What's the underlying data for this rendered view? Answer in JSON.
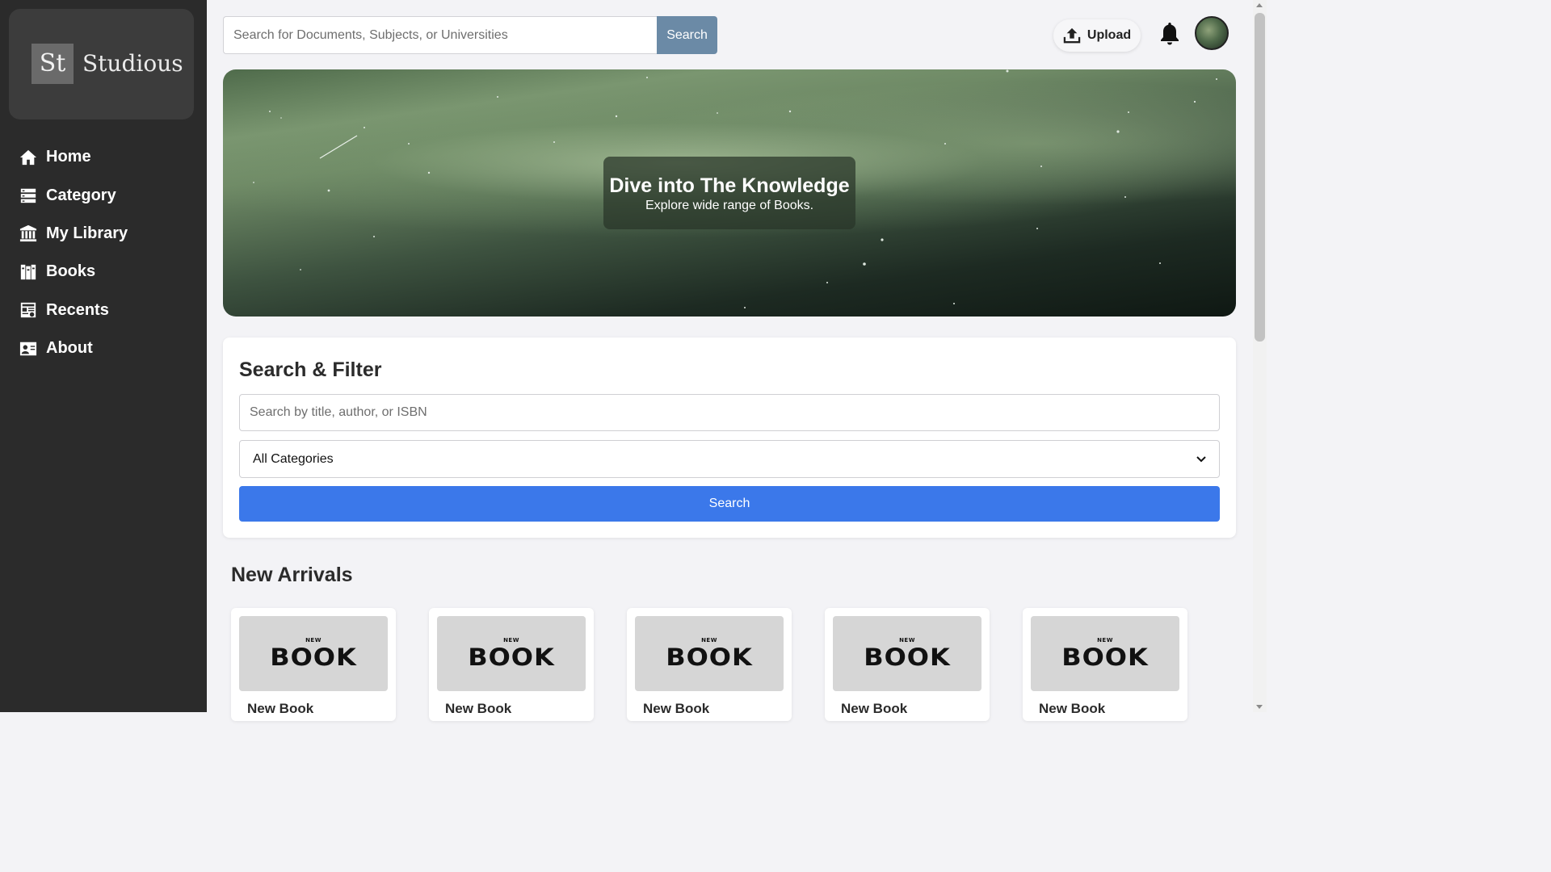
{
  "brand": {
    "mark": "St",
    "name": "Studious"
  },
  "sidebar": {
    "items": [
      {
        "label": "Home",
        "icon": "home-icon"
      },
      {
        "label": "Category",
        "icon": "category-icon"
      },
      {
        "label": "My Library",
        "icon": "library-icon"
      },
      {
        "label": "Books",
        "icon": "books-icon"
      },
      {
        "label": "Recents",
        "icon": "recents-icon"
      },
      {
        "label": "About",
        "icon": "about-icon"
      }
    ]
  },
  "topbar": {
    "search_placeholder": "Search for Documents, Subjects, or Universities",
    "search_button": "Search",
    "upload_label": "Upload"
  },
  "hero": {
    "title": "Dive into The Knowledge",
    "subtitle": "Explore wide range of Books."
  },
  "filter": {
    "title": "Search & Filter",
    "input_placeholder": "Search by title, author, or ISBN",
    "category_selected": "All Categories",
    "search_button": "Search"
  },
  "arrivals": {
    "title": "New Arrivals",
    "books": [
      {
        "cover_small": "NEW",
        "cover_big": "BOOK",
        "title": "New Book"
      },
      {
        "cover_small": "NEW",
        "cover_big": "BOOK",
        "title": "New Book"
      },
      {
        "cover_small": "NEW",
        "cover_big": "BOOK",
        "title": "New Book"
      },
      {
        "cover_small": "NEW",
        "cover_big": "BOOK",
        "title": "New Book"
      },
      {
        "cover_small": "NEW",
        "cover_big": "BOOK",
        "title": "New Book"
      }
    ]
  },
  "colors": {
    "sidebar_bg": "#2b2b2b",
    "search_button": "#6b8aa6",
    "primary_button": "#3b78ea",
    "page_bg": "#f3f3f6"
  }
}
